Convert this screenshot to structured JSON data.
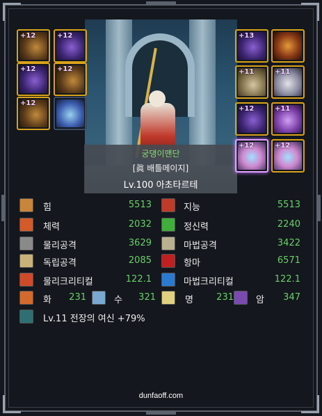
{
  "character": {
    "guild": "궁댕이맨단",
    "job": "[眞 배틀메이지]",
    "level": "Lv.100 아초타르테"
  },
  "equipment": {
    "left": [
      {
        "plus": "+12",
        "icon": "gauntlet-icon"
      },
      {
        "plus": "+12",
        "icon": "creature-icon"
      },
      {
        "plus": "+12",
        "icon": "shoulder-armor-icon"
      },
      {
        "plus": "+12",
        "icon": "chest-armor-icon"
      },
      {
        "plus": "+12",
        "icon": "boots-icon"
      },
      {
        "plus": "",
        "icon": "pet-icon"
      }
    ],
    "right": [
      {
        "plus": "+13",
        "icon": "weapon-icon"
      },
      {
        "plus": "",
        "icon": "title-icon"
      },
      {
        "plus": "+11",
        "icon": "ring-icon"
      },
      {
        "plus": "+11",
        "icon": "necklace-icon"
      },
      {
        "plus": "+12",
        "icon": "bracelet-icon"
      },
      {
        "plus": "+11",
        "icon": "support-icon"
      },
      {
        "plus": "+12",
        "icon": "magic-stone-icon"
      },
      {
        "plus": "+12",
        "icon": "earring-icon"
      }
    ]
  },
  "stats": {
    "left": [
      {
        "label": "힘",
        "value": "5513",
        "icon": "strength-icon",
        "color": "#c9853a"
      },
      {
        "label": "체력",
        "value": "2032",
        "icon": "vitality-icon",
        "color": "#d45a2a"
      },
      {
        "label": "물리공격",
        "value": "3629",
        "icon": "sword-icon",
        "color": "#b8b8b8"
      },
      {
        "label": "독립공격",
        "value": "2085",
        "icon": "independent-attack-icon",
        "color": "#c9b27a"
      },
      {
        "label": "물리크리티컬",
        "value": "122.1",
        "icon": "physical-critical-icon",
        "color": "#d04a2a"
      }
    ],
    "right": [
      {
        "label": "지능",
        "value": "5513",
        "icon": "intelligence-icon",
        "color": "#c03a2a"
      },
      {
        "label": "정신력",
        "value": "2240",
        "icon": "spirit-icon",
        "color": "#3fae3a"
      },
      {
        "label": "마법공격",
        "value": "3422",
        "icon": "magic-attack-icon",
        "color": "#e6e0c0"
      },
      {
        "label": "항마",
        "value": "6571",
        "icon": "anti-magic-icon",
        "color": "#c02020"
      },
      {
        "label": "마법크리티컬",
        "value": "122.1",
        "icon": "magic-critical-icon",
        "color": "#2a7ad0"
      }
    ],
    "elements": [
      {
        "label": "화",
        "value": "231",
        "icon": "fire-icon",
        "color": "#d46a2a"
      },
      {
        "label": "수",
        "value": "321",
        "icon": "water-icon",
        "color": "#7aa8d0"
      },
      {
        "label": "명",
        "value": "231",
        "icon": "light-icon",
        "color": "#e0d080"
      },
      {
        "label": "암",
        "value": "347",
        "icon": "dark-icon",
        "color": "#7a4ab0"
      }
    ],
    "buff": {
      "label": "Lv.11 전장의 여신 +79%",
      "icon": "buff-icon",
      "color": "#4aa0a0"
    }
  },
  "footer": "dunfaoff.com"
}
